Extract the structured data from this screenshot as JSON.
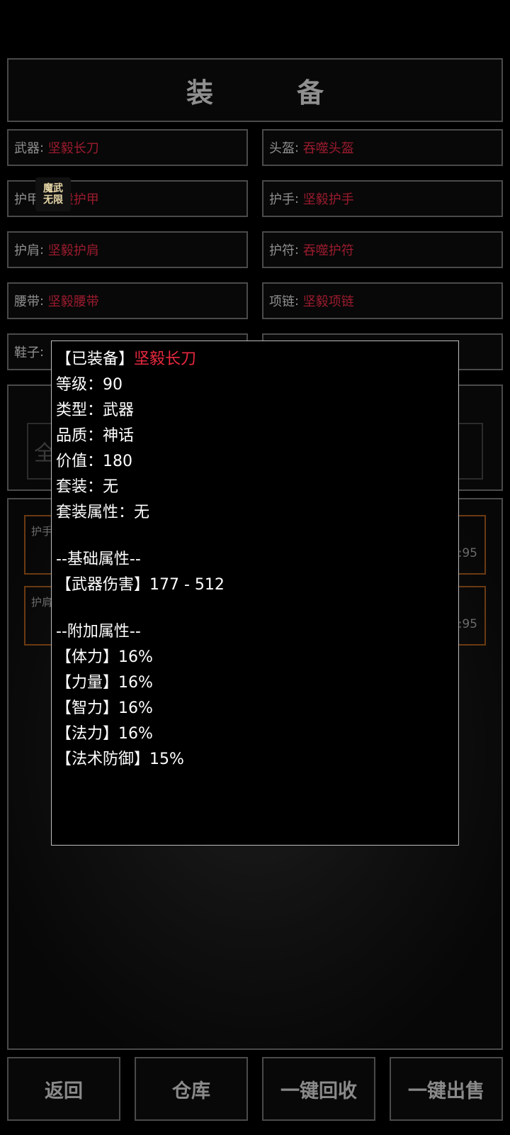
{
  "title": "装　备",
  "slots": [
    {
      "label": "武器",
      "item": "坚毅长刀"
    },
    {
      "label": "头盔",
      "item": "吞噬头盔"
    },
    {
      "label": "护甲",
      "item": "坚毅护甲"
    },
    {
      "label": "护手",
      "item": "坚毅护手"
    },
    {
      "label": "护肩",
      "item": "坚毅护肩"
    },
    {
      "label": "护符",
      "item": "吞噬护符"
    },
    {
      "label": "腰带",
      "item": "坚毅腰带"
    },
    {
      "label": "项链",
      "item": "坚毅项链"
    },
    {
      "label": "鞋子",
      "item": ""
    }
  ],
  "search_placeholder": "全",
  "list_items": [
    {
      "name": "护手",
      "value": ":95"
    },
    {
      "name": "护肩",
      "value": ":95"
    }
  ],
  "logo": {
    "line1": "魔武",
    "line2": "无限"
  },
  "tooltip": {
    "header_prefix": "【已装备】",
    "header_name": "坚毅长刀",
    "level": "等级：90",
    "type": "类型：武器",
    "quality": "品质：神话",
    "value": "价值：180",
    "set": "套装：无",
    "set_attr": "套装属性：无",
    "base_title": "--基础属性--",
    "base_attrs": [
      "【武器伤害】177 - 512"
    ],
    "extra_title": "--附加属性--",
    "extra_attrs": [
      "【体力】16%",
      "【力量】16%",
      "【智力】16%",
      "【法力】16%",
      "【法术防御】15%"
    ]
  },
  "buttons": {
    "back": "返回",
    "warehouse": "仓库",
    "recycle_all": "一键回收",
    "sell_all": "一键出售"
  },
  "colors": {
    "item_red": "#9b1b2e",
    "tooltip_name": "#e8283e",
    "border": "#4a4a4a"
  }
}
